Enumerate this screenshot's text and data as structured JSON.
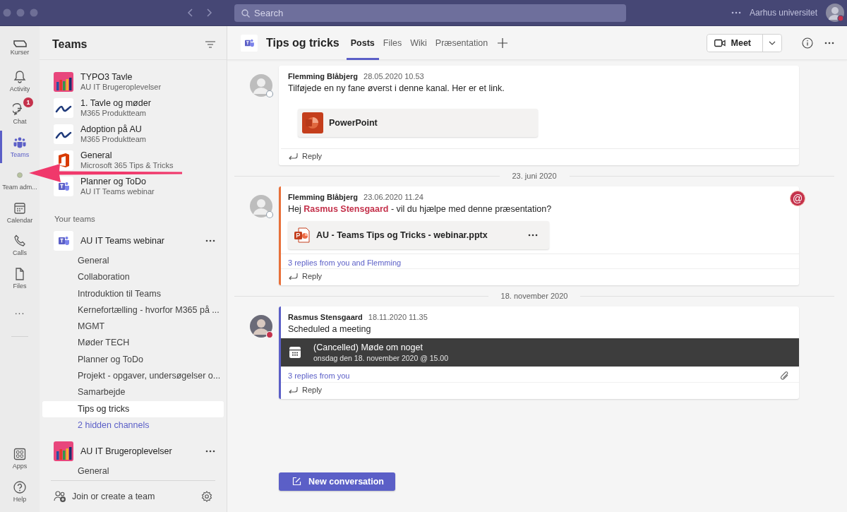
{
  "titlebar": {
    "search_placeholder": "Search",
    "org": "Aarhus universitet",
    "status": {
      "color": "#c4314b"
    }
  },
  "rail": {
    "items": [
      {
        "label": "Kurser",
        "selected": false
      },
      {
        "label": "Activity",
        "selected": false
      },
      {
        "label": "Chat",
        "selected": false,
        "badge": "1"
      },
      {
        "label": "Teams",
        "selected": true
      },
      {
        "label": "Team adm...",
        "selected": false
      },
      {
        "label": "Calendar",
        "selected": false
      },
      {
        "label": "Calls",
        "selected": false
      },
      {
        "label": "Files",
        "selected": false
      },
      {
        "label": "...",
        "selected": false
      }
    ],
    "bottom_items": [
      {
        "label": "Apps",
        "selected": false
      },
      {
        "label": "Help",
        "selected": false
      }
    ]
  },
  "teams_panel": {
    "title": "Teams",
    "pinned": [
      {
        "name": "TYPO3 Tavle",
        "subtitle": "AU IT Brugeroplevelser"
      },
      {
        "name": "1. Tavle og møder",
        "subtitle": "M365 Produktteam"
      },
      {
        "name": "Adoption på AU",
        "subtitle": "M365 Produktteam"
      },
      {
        "name": "General",
        "subtitle": "Microsoft 365 Tips & Tricks"
      },
      {
        "name": "Planner og ToDo",
        "subtitle": "AU IT Teams webinar"
      }
    ],
    "section": "Your teams",
    "teams": [
      {
        "name": "AU IT Teams webinar",
        "channels": [
          {
            "name": "General",
            "selected": false
          },
          {
            "name": "Collaboration",
            "selected": false
          },
          {
            "name": "Introduktion til Teams",
            "selected": false
          },
          {
            "name": "Kernefortælling - hvorfor M365 på ...",
            "selected": false
          },
          {
            "name": "MGMT",
            "selected": false
          },
          {
            "name": "Møder TECH",
            "selected": false
          },
          {
            "name": "Planner og ToDo",
            "selected": false
          },
          {
            "name": "Projekt - opgaver, undersøgelser o...",
            "selected": false
          },
          {
            "name": "Samarbejde",
            "selected": false
          },
          {
            "name": "Tips og tricks",
            "selected": true
          }
        ],
        "hidden_link": "2 hidden channels"
      },
      {
        "name": "AU IT Brugeroplevelser",
        "channels": [
          {
            "name": "General",
            "selected": false
          }
        ]
      }
    ],
    "footer": "Join or create a team"
  },
  "channel": {
    "title": "Tips og tricks",
    "tabs": [
      {
        "label": "Posts",
        "selected": true
      },
      {
        "label": "Files",
        "selected": false
      },
      {
        "label": "Wiki",
        "selected": false
      },
      {
        "label": "Præsentation",
        "selected": false
      }
    ],
    "meet": "Meet"
  },
  "feed": [
    {
      "kind": "post",
      "author": "Flemming Blåbjerg",
      "time": "28.05.2020 10.53",
      "status": {
        "color": "#9aa6b2"
      },
      "text": "Tilføjede en ny fane øverst i denne kanal. Her er et link.",
      "attachment": {
        "kind": "link",
        "name": "PowerPoint"
      },
      "reply": "Reply"
    },
    {
      "kind": "date",
      "text": "23. juni 2020"
    },
    {
      "kind": "post",
      "author": "Flemming Blåbjerg",
      "time": "23.06.2020 11.24",
      "status": {
        "color": "#9aa6b2"
      },
      "accent": {
        "color": "#e8703a"
      },
      "mention_badge": "@",
      "text": "Hej **Rasmus Stensgaard** - vil du hjælpe med denne præsentation?",
      "attachment": {
        "kind": "file",
        "name": "AU - Teams Tips og Tricks - webinar.pptx"
      },
      "replies": "3 replies from you and Flemming",
      "reply": "Reply"
    },
    {
      "kind": "date",
      "text": "18. november 2020"
    },
    {
      "kind": "post",
      "author": "Rasmus Stensgaard",
      "time": "18.11.2020 11.35",
      "status": {
        "color": "#c4314b"
      },
      "accent": {
        "color": "#5b5fc7"
      },
      "text": "Scheduled a meeting",
      "meeting": {
        "title": "(Cancelled) Møde om noget",
        "when": "onsdag den 18. november 2020 @ 15.00"
      },
      "replies": "3 replies from you",
      "paperclip": true,
      "reply": "Reply"
    }
  ],
  "new_conversation": "New conversation"
}
